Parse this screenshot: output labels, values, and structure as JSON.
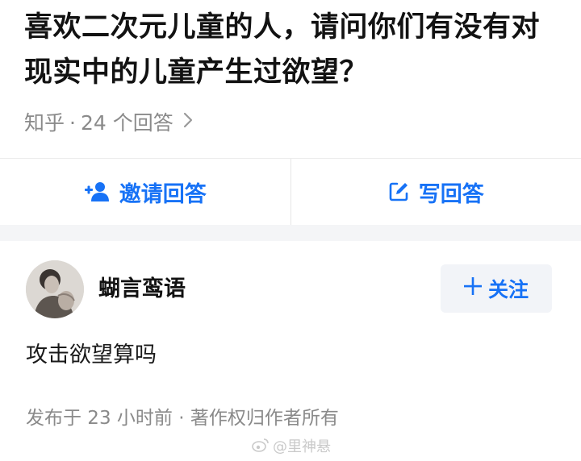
{
  "question": {
    "title": "喜欢二次元儿童的人，请问你们有没有对现实中的儿童产生过欲望？",
    "source": "知乎",
    "separator": "·",
    "answer_count": "24 个回答",
    "chevron_icon": "chevron-right-icon"
  },
  "actions": {
    "invite_label": "邀请回答",
    "invite_icon": "add-user-icon",
    "write_label": "写回答",
    "write_icon": "edit-icon",
    "accent_color": "#1772f6"
  },
  "answer": {
    "author_name": "蝴言鸾语",
    "follow_label": "关注",
    "follow_icon": "plus-icon",
    "content": "攻击欲望算吗",
    "meta": "发布于 23 小时前 · 著作权归作者所有"
  },
  "watermark": {
    "text": "@里神悬",
    "icon": "weibo-icon"
  }
}
